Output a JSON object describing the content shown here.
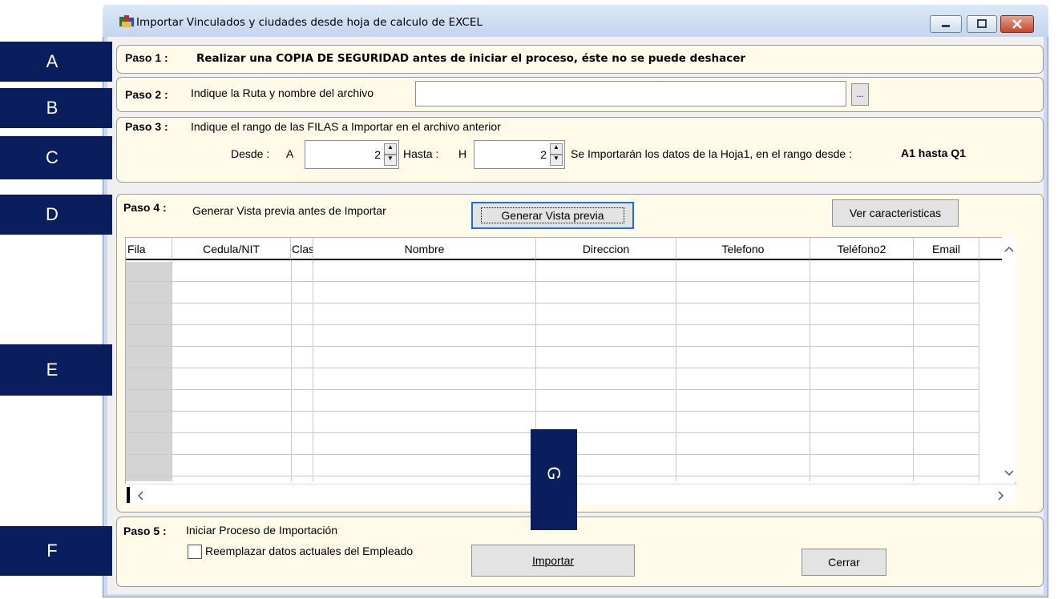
{
  "window": {
    "title": "Importar Vinculados y ciudades desde hoja de calculo de EXCEL",
    "controls": {
      "minimize": "minimize-icon",
      "maximize": "maximize-icon",
      "close": "close-icon"
    }
  },
  "markers": [
    "A",
    "B",
    "C",
    "D",
    "E",
    "F",
    "G"
  ],
  "paso1": {
    "label": "Paso 1 :",
    "text": "Realizar una COPIA DE SEGURIDAD antes de iniciar el proceso, éste no se puede deshacer"
  },
  "paso2": {
    "label": "Paso 2 :",
    "text": "Indique la Ruta y nombre del archivo",
    "path_value": "",
    "browse_label": "..."
  },
  "paso3": {
    "label": "Paso 3 :",
    "text": "Indique el rango de las FILAS a Importar en el archivo anterior",
    "desde_label": "Desde :",
    "desde_col": "A",
    "desde_value": "2",
    "hasta_label": "Hasta :",
    "hasta_col": "H",
    "hasta_value": "2",
    "info": "Se Importarán los datos de la Hoja1,  en el rango desde :",
    "range": "A1 hasta Q1"
  },
  "paso4": {
    "label": "Paso 4 :",
    "text": "Generar Vista previa antes de Importar",
    "preview_button": "Generar Vista previa",
    "features_button": "Ver caracteristicas",
    "columns": [
      "Fila",
      "Cedula/NIT",
      "Clas",
      "Nombre",
      "Direccion",
      "Telefono",
      "Teléfono2",
      "Email"
    ]
  },
  "paso5": {
    "label": "Paso 5 :",
    "text": "Iniciar Proceso de Importación",
    "checkbox_label": "Reemplazar datos actuales del Empleado",
    "checkbox_checked": false,
    "import_button": "Importar",
    "close_button": "Cerrar"
  },
  "colors": {
    "marker": "#0a1d5c",
    "panel": "#fffbe8",
    "focus": "#1e6fd9"
  }
}
